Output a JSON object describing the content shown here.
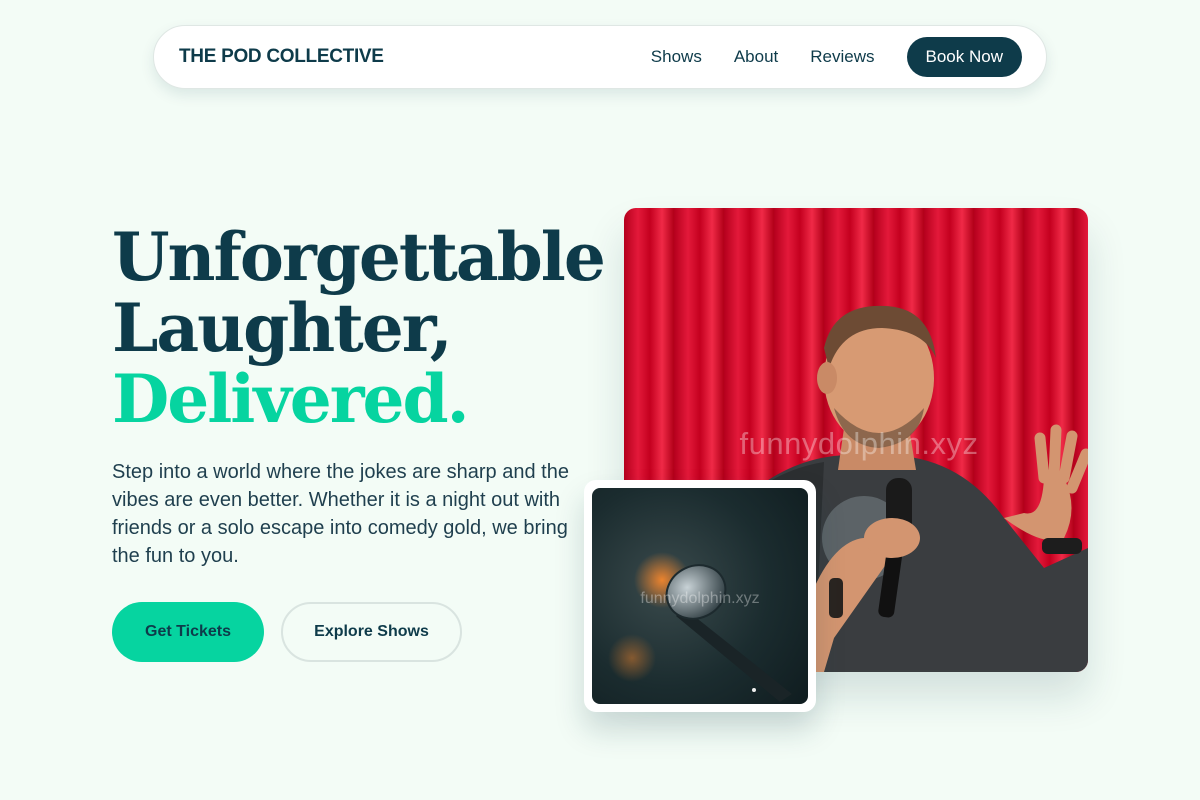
{
  "nav": {
    "brand": "THE POD COLLECTIVE",
    "links": [
      "Shows",
      "About",
      "Reviews"
    ],
    "cta": "Book Now"
  },
  "hero": {
    "title_line1": "Unforgettable",
    "title_line2": "Laughter,",
    "title_accent": "Delivered.",
    "body": "Step into a world where the jokes are sharp and the vibes are even better. Whether it is a night out with friends or a solo escape into comedy gold, we bring the fun to you.",
    "primary_cta": "Get Tickets",
    "secondary_cta": "Explore Shows"
  },
  "media": {
    "main_watermark": "funnydolphin.xyz",
    "small_watermark": "funnydolphin.xyz"
  },
  "colors": {
    "background": "#f3fcf6",
    "primary_dark": "#0e3b4a",
    "accent": "#06d4a0",
    "curtain_red": "#e3193a"
  }
}
